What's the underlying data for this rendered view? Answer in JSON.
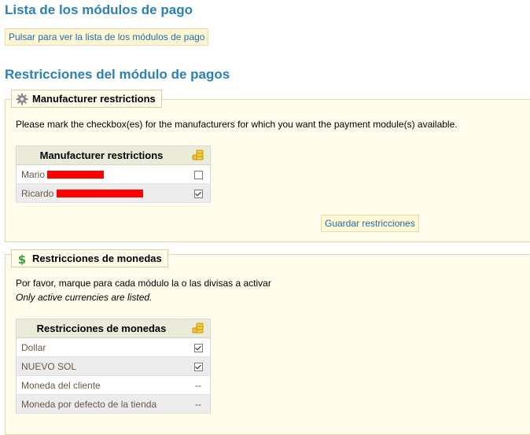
{
  "payment_list": {
    "title": "Lista de los módulos de pago",
    "link_label": "Pulsar para ver la lista de los módulos de pago"
  },
  "restrictions": {
    "title": "Restricciones del módulo de pagos"
  },
  "manufacturers": {
    "legend": "Manufacturer restrictions",
    "legend_icon": "gear-icon",
    "instruction": "Please mark the checkbox(es) for the manufacturers for which you want the payment module(s) available.",
    "table_header": "Manufacturer restrictions",
    "header_icon": "coins-icon",
    "rows": [
      {
        "name": "Mario",
        "checked": false,
        "redacted": true
      },
      {
        "name": "Ricardo",
        "checked": true,
        "redacted": true
      }
    ],
    "save_label": "Guardar restricciones"
  },
  "currencies": {
    "legend": "Restricciones de monedas",
    "legend_icon": "dollar-icon",
    "instruction": "Por favor, marque para cada módulo la o las divisas a activar",
    "note": "Only active currencies are listed.",
    "table_header": "Restricciones de monedas",
    "header_icon": "coins-icon",
    "rows": [
      {
        "name": "Dollar",
        "checked": true,
        "value": ""
      },
      {
        "name": "NUEVO SOL",
        "checked": true,
        "value": ""
      },
      {
        "name": "Moneda del cliente",
        "checked": null,
        "value": "--"
      },
      {
        "name": "Moneda por defecto de la tienda",
        "checked": null,
        "value": "--"
      }
    ]
  },
  "colors": {
    "heading": "#2a80b9",
    "panel_bg": "#fffcec",
    "redaction": "#ff0000"
  }
}
